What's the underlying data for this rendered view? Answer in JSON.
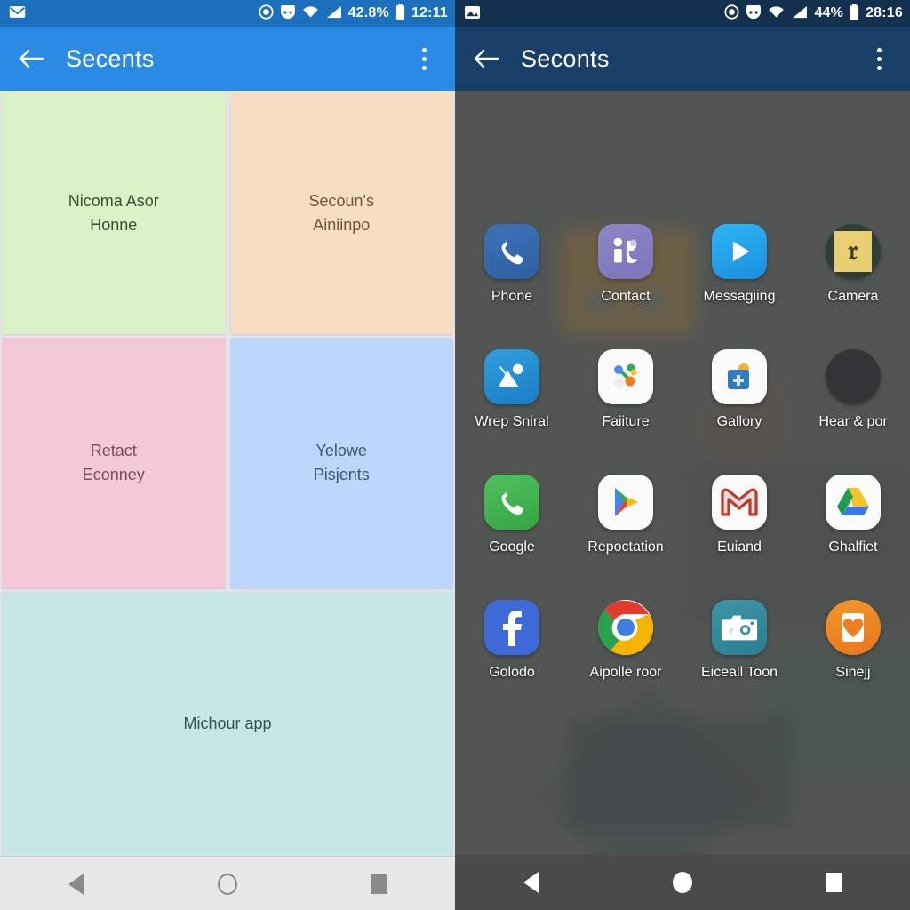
{
  "left": {
    "theme": {
      "status_bar": "#1d70bd",
      "app_bar": "#2b8ae4"
    },
    "status": {
      "mail_icon": "mail-icon",
      "record_icon": "record-icon",
      "mask_icon": "mask-icon",
      "wifi_icon": "wifi-icon",
      "signal_icon": "signal-icon",
      "battery_percent": "42.8%",
      "battery_icon": "battery-icon",
      "time": "12:11"
    },
    "appbar": {
      "back_icon": "back-arrow-icon",
      "title": "Secents",
      "overflow_icon": "overflow-menu-icon"
    },
    "tiles": [
      {
        "line1": "Nicoma Asor",
        "line2": "Honne",
        "color": "#dbf2c8"
      },
      {
        "line1": "Secoun's",
        "line2": "Ainiinpo",
        "color": "#f7ddc1"
      },
      {
        "line1": "Retact",
        "line2": "Econney",
        "color": "#f4c9d7"
      },
      {
        "line1": "Yelowe",
        "line2": "Pisjents",
        "color": "#bed6fb"
      },
      {
        "line1": "Michour app",
        "line2": "",
        "color": "#c6e6e6"
      }
    ],
    "nav": {
      "back": "nav-back-icon",
      "home": "nav-home-icon",
      "recents": "nav-recents-icon"
    }
  },
  "right": {
    "theme": {
      "status_bar": "#13304f",
      "app_bar": "#1a3f69",
      "wallpaper": "#5b605d"
    },
    "status": {
      "image_icon": "image-icon",
      "record_icon": "record-icon",
      "mask_icon": "mask-icon",
      "wifi_icon": "wifi-icon",
      "signal_icon": "signal-icon",
      "battery_percent": "44%",
      "battery_icon": "battery-icon",
      "time": "28:16"
    },
    "appbar": {
      "back_icon": "back-arrow-icon",
      "title": "Seconts",
      "overflow_icon": "overflow-menu-icon"
    },
    "apps": [
      {
        "label": "Phone",
        "icon": "phone-icon"
      },
      {
        "label": "Contact",
        "icon": "contacts-icon"
      },
      {
        "label": "Messagiing",
        "icon": "messaging-icon"
      },
      {
        "label": "Camera",
        "icon": "camera-icon"
      },
      {
        "label": "Wrep Sniral",
        "icon": "wallpaper-icon"
      },
      {
        "label": "Faiiture",
        "icon": "features-icon"
      },
      {
        "label": "Gallory",
        "icon": "gallery-icon"
      },
      {
        "label": "Hear & por",
        "icon": "folder-icon"
      },
      {
        "label": "Google",
        "icon": "phone-green-icon"
      },
      {
        "label": "Repoctation",
        "icon": "play-store-icon"
      },
      {
        "label": "Euiand",
        "icon": "gmail-icon"
      },
      {
        "label": "Ghalfiet",
        "icon": "drive-icon"
      },
      {
        "label": "Golodo",
        "icon": "facebook-icon"
      },
      {
        "label": "Aipolle roor",
        "icon": "chrome-icon"
      },
      {
        "label": "Eiceall Toon",
        "icon": "camera-teal-icon"
      },
      {
        "label": "Sinejj",
        "icon": "heart-icon"
      }
    ],
    "nav": {
      "back": "nav-back-icon",
      "home": "nav-home-icon",
      "recents": "nav-recents-icon"
    }
  }
}
